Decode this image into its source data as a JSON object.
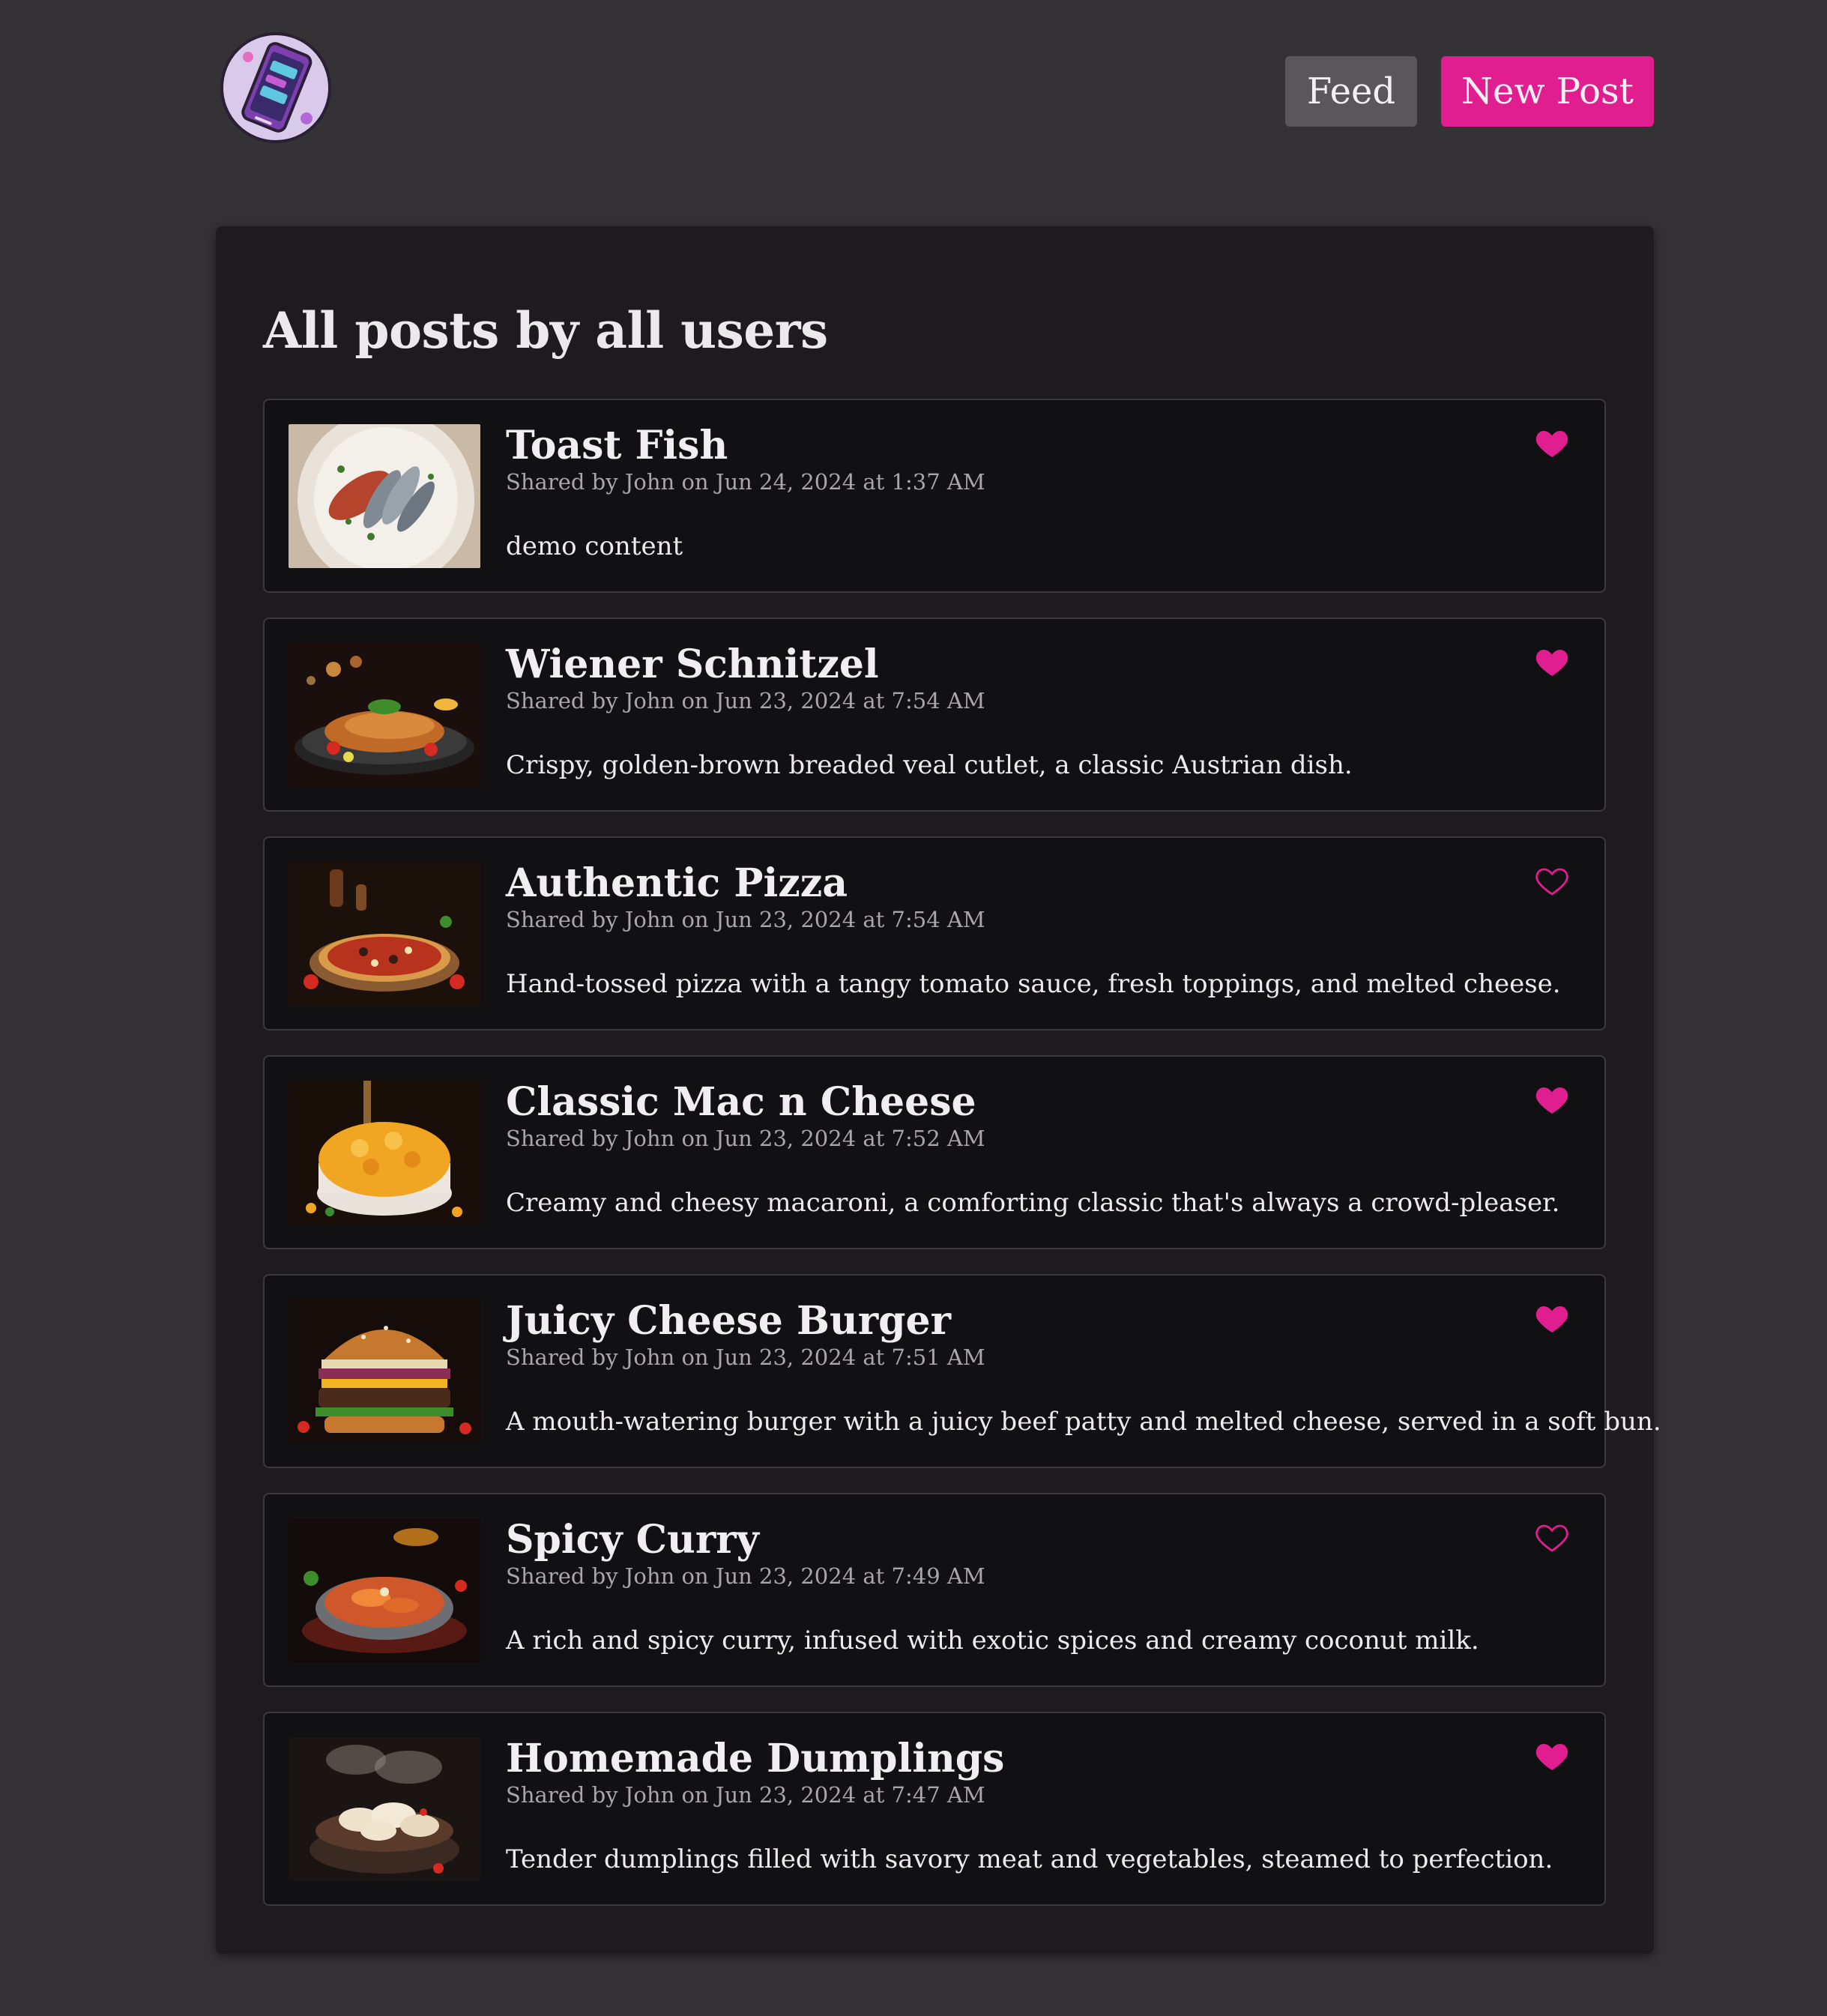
{
  "header": {
    "logo_icon": "phone-app-logo-icon",
    "nav": {
      "feed_label": "Feed",
      "new_post_label": "New Post"
    }
  },
  "colors": {
    "page_bg": "#353235",
    "panel_bg": "#1e1b1e",
    "card_bg": "#111012",
    "accent": "#e01e8f",
    "feed_button": "#5a575a"
  },
  "main": {
    "title": "All posts by all users",
    "posts": [
      {
        "title": "Toast Fish",
        "meta": "Shared by John on Jun 24, 2024 at 1:37 AM",
        "content": "demo content",
        "liked": true,
        "image_icon": "fish-dish-photo"
      },
      {
        "title": "Wiener Schnitzel",
        "meta": "Shared by John on Jun 23, 2024 at 7:54 AM",
        "content": "Crispy, golden-brown breaded veal cutlet, a classic Austrian dish.",
        "liked": true,
        "image_icon": "schnitzel-photo"
      },
      {
        "title": "Authentic Pizza",
        "meta": "Shared by John on Jun 23, 2024 at 7:54 AM",
        "content": "Hand-tossed pizza with a tangy tomato sauce, fresh toppings, and melted cheese.",
        "liked": false,
        "image_icon": "pizza-photo"
      },
      {
        "title": "Classic Mac n Cheese",
        "meta": "Shared by John on Jun 23, 2024 at 7:52 AM",
        "content": "Creamy and cheesy macaroni, a comforting classic that's always a crowd-pleaser.",
        "liked": true,
        "image_icon": "mac-and-cheese-photo"
      },
      {
        "title": "Juicy Cheese Burger",
        "meta": "Shared by John on Jun 23, 2024 at 7:51 AM",
        "content": "A mouth-watering burger with a juicy beef patty and melted cheese, served in a soft bun.",
        "liked": true,
        "image_icon": "burger-photo"
      },
      {
        "title": "Spicy Curry",
        "meta": "Shared by John on Jun 23, 2024 at 7:49 AM",
        "content": "A rich and spicy curry, infused with exotic spices and creamy coconut milk.",
        "liked": false,
        "image_icon": "curry-photo"
      },
      {
        "title": "Homemade Dumplings",
        "meta": "Shared by John on Jun 23, 2024 at 7:47 AM",
        "content": "Tender dumplings filled with savory meat and vegetables, steamed to perfection.",
        "liked": true,
        "image_icon": "dumplings-photo"
      }
    ]
  }
}
